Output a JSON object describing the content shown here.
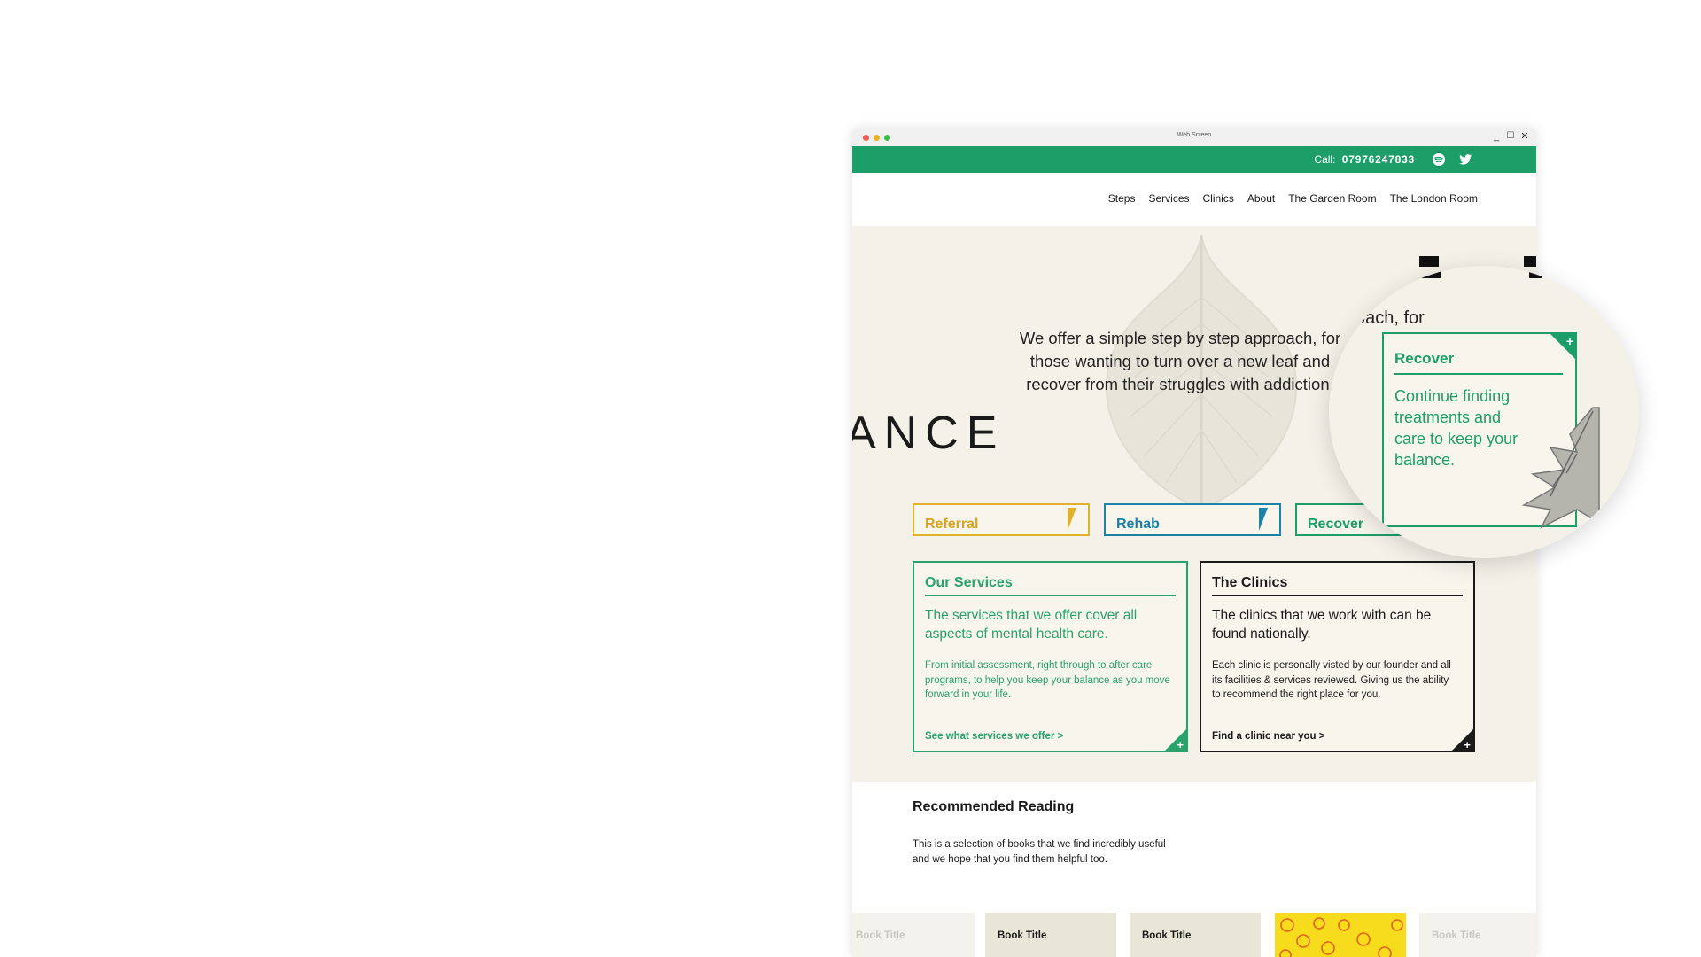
{
  "window": {
    "title": "Web Screen"
  },
  "topbar": {
    "call_label": "Call:",
    "phone": "07976247833"
  },
  "nav": {
    "items": [
      "Steps",
      "Services",
      "Clinics",
      "About",
      "The Garden Room",
      "The London Room"
    ]
  },
  "hero": {
    "fragment": "ANCE",
    "text": "We offer a simple step by step approach, for those wanting to turn over a new leaf and recover from their struggles with addiction."
  },
  "steps": [
    {
      "label": "Referral",
      "color": "#e3b12e"
    },
    {
      "label": "Rehab",
      "color": "#1b82a8"
    },
    {
      "label": "Recover",
      "color": "#1d9e69"
    }
  ],
  "services_card": {
    "title": "Our Services",
    "lead": "The services that we offer cover all aspects of mental health care.",
    "body": "From initial assessment, right through to after care programs, to help you keep your balance as you move forward in your life.",
    "link": "See what services we offer   >"
  },
  "clinics_card": {
    "title": "The Clinics",
    "lead": "The clinics that we work with can be found nationally.",
    "body": "Each clinic is personally visted by our founder and all its facilities & services reviewed.  Giving us the ability to recommend the right place for you.",
    "link": "Find a clinic near you   >"
  },
  "reading": {
    "title": "Recommended Reading",
    "text": "This is a selection of books that we find incredibly useful and we hope that you find them helpful too."
  },
  "books": [
    "Book Title",
    "Book Title",
    "Book Title",
    "",
    "Book Title"
  ],
  "magnifier": {
    "text_fragment": "oach, for",
    "card_title": "Recover",
    "card_text": "Continue finding treatments and care to keep your balance."
  },
  "colors": {
    "brand_green": "#1d9e69",
    "hero_bg": "#f4f2e8",
    "referral": "#e3b12e",
    "rehab": "#1b82a8"
  }
}
